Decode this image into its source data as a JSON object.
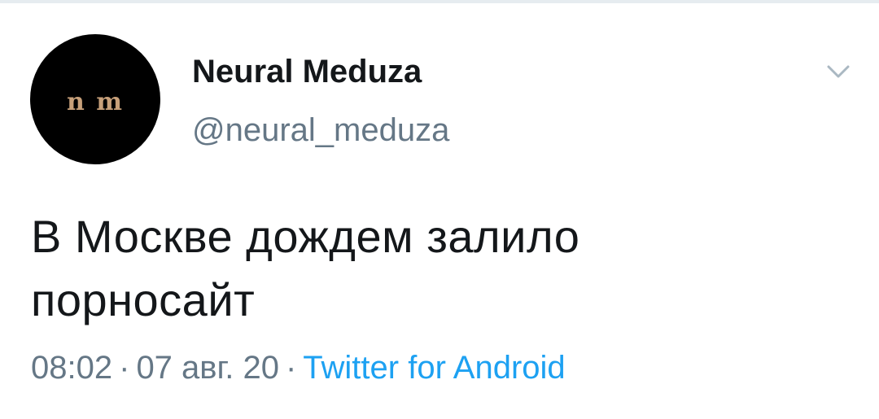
{
  "tweet": {
    "avatar": {
      "logo_text": "n m",
      "background": "#000000",
      "logo_color": "#c7a07a"
    },
    "author": {
      "display_name": "Neural Meduza",
      "handle": "@neural_meduza"
    },
    "menu_icon": "chevron-down-icon",
    "text_line1": "В Москве дождем залило",
    "text_line2": "порносайт",
    "time": "08:02",
    "separator": "·",
    "date": "07 авг. 20",
    "source": "Twitter for Android"
  },
  "colors": {
    "text_primary": "#14171a",
    "text_secondary": "#657786",
    "link": "#1da1f2",
    "border": "#e6ecf0"
  }
}
